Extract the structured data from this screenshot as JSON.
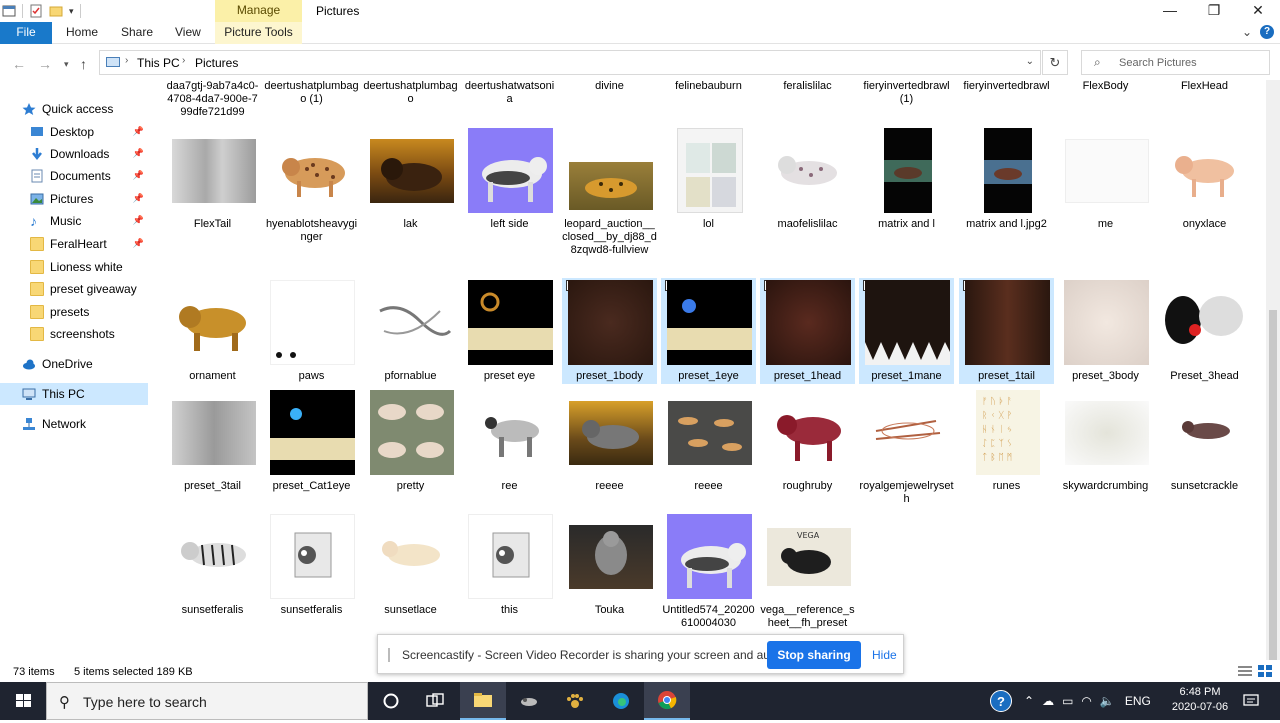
{
  "window": {
    "title": "Pictures",
    "manage_tab": "Manage",
    "minimize": "—",
    "maximize": "❐",
    "close": "✕"
  },
  "ribbon": {
    "file": "File",
    "home": "Home",
    "share": "Share",
    "view": "View",
    "picture_tools": "Picture Tools",
    "collapse": "⌄",
    "help": "?"
  },
  "address": {
    "crumbs": [
      "This PC",
      "Pictures"
    ],
    "search_placeholder": "Search Pictures"
  },
  "nav": {
    "quick_access": "Quick access",
    "items": [
      {
        "label": "Desktop",
        "pinned": true
      },
      {
        "label": "Downloads",
        "pinned": true
      },
      {
        "label": "Documents",
        "pinned": true
      },
      {
        "label": "Pictures",
        "pinned": true
      },
      {
        "label": "Music",
        "pinned": true
      },
      {
        "label": "FeralHeart",
        "pinned": true
      },
      {
        "label": "Lioness white",
        "pinned": false
      },
      {
        "label": "preset giveaway",
        "pinned": false
      },
      {
        "label": "presets",
        "pinned": false
      },
      {
        "label": "screenshots",
        "pinned": false
      }
    ],
    "onedrive": "OneDrive",
    "this_pc": "This PC",
    "network": "Network"
  },
  "files": {
    "row0": [
      "daa7gtj-9ab7a4c0-4708-4da7-900e-799dfe721d99",
      "deertushatplumbago (1)",
      "deertushatplumbago",
      "deertushatwatsonia",
      "divine",
      "felinebauburn",
      "feralislilac",
      "fieryinvertedbrawl (1)",
      "fieryinvertedbrawl",
      "FlexBody",
      "FlexHead"
    ],
    "row1": [
      "FlexTail",
      "hyenablotsheavyginger",
      "lak",
      "left side",
      "leopard_auction__closed__by_dj88_d8zqwd8-fullview",
      "lol",
      "maofelislilac",
      "matrix and l",
      "matrix and l.jpg2",
      "me",
      "onyxlace"
    ],
    "row2": [
      "ornament",
      "paws",
      "pfornablue",
      "preset eye",
      "preset_1body",
      "preset_1eye",
      "preset_1head",
      "preset_1mane",
      "preset_1tail",
      "preset_3body",
      "Preset_3head"
    ],
    "row3": [
      "preset_3tail",
      "preset_Cat1eye",
      "pretty",
      "ree",
      "reeee",
      "reeee",
      "roughruby",
      "royalgemjewelryseth",
      "runes",
      "skywardcrumbing",
      "sunsetcrackle"
    ],
    "row4": [
      "sunsetferalis",
      "sunsetferalis",
      "sunsetlace",
      "this",
      "Touka",
      "Untitled574_20200610004030",
      "vega__reference_sheet__fh_preset"
    ]
  },
  "status": {
    "count": "73 items",
    "selected": "5 items selected  189 KB"
  },
  "screencastify": {
    "message": "Screencastify - Screen Video Recorder is sharing your screen and audio.",
    "stop": "Stop sharing",
    "hide": "Hide"
  },
  "taskbar": {
    "search_placeholder": "Type here to search",
    "lang": "ENG",
    "time": "6:48 PM",
    "date": "2020-07-06"
  },
  "colors": {
    "accent": "#1979ca",
    "selection": "#cce8ff",
    "manage": "#fbf0a8",
    "taskbar": "#1f2430"
  }
}
